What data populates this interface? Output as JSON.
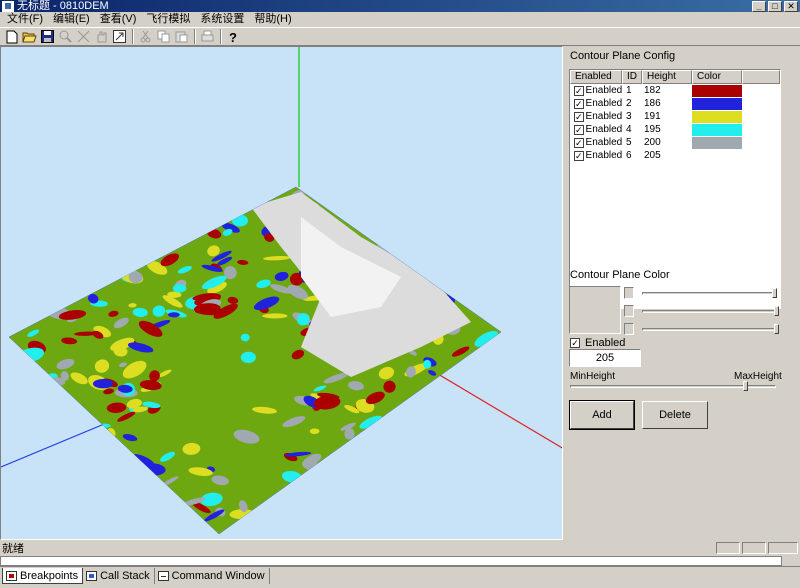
{
  "window": {
    "title": "无标题 - 0810DEM",
    "minimize": "_",
    "maximize": "□",
    "close": "✕"
  },
  "menu": [
    "文件(F)",
    "编辑(E)",
    "查看(V)",
    "飞行模拟",
    "系统设置",
    "帮助(H)"
  ],
  "toolbar": {
    "icons": [
      "new-icon",
      "open-icon",
      "save-icon",
      "zoom-icon",
      "zoom-fit-icon",
      "pan-icon",
      "rotate-icon",
      "cut-icon",
      "copy-icon",
      "paste-icon",
      "print-preview-icon",
      "print-icon",
      "help-icon"
    ]
  },
  "viewport": {
    "axis_colors": {
      "y": "#00cc00",
      "x": "#e02020",
      "z": "#1f3fe0"
    },
    "contour_colors": [
      "#aa0000",
      "#2222dd",
      "#dddd22",
      "#22eeee",
      "#a0a8b0"
    ],
    "low_terrain_color": "#6ea810",
    "high_terrain_color": "#d8d8d8"
  },
  "contour_config": {
    "title": "Contour Plane Config",
    "columns": [
      "Enabled",
      "ID",
      "Height",
      "Color"
    ],
    "rows": [
      {
        "enabled": "Enabled",
        "id": "1",
        "height": "182",
        "color": "#aa0000"
      },
      {
        "enabled": "Enabled",
        "id": "2",
        "height": "186",
        "color": "#2222dd"
      },
      {
        "enabled": "Enabled",
        "id": "3",
        "height": "191",
        "color": "#dddd22"
      },
      {
        "enabled": "Enabled",
        "id": "4",
        "height": "195",
        "color": "#22eeee"
      },
      {
        "enabled": "Enabled",
        "id": "5",
        "height": "200",
        "color": "#a0a8b0"
      },
      {
        "enabled": "Enabled",
        "id": "6",
        "height": "205",
        "color": ""
      }
    ]
  },
  "plane_color": {
    "title": "Contour Plane Color",
    "enabled_label": "Enabled",
    "height_value": "205",
    "min_label": "MinHeight",
    "max_label": "MaxHeight",
    "add_label": "Add",
    "delete_label": "Delete"
  },
  "status": {
    "text": "就绪"
  },
  "tabs": [
    "Breakpoints",
    "Call Stack",
    "Command Window"
  ]
}
